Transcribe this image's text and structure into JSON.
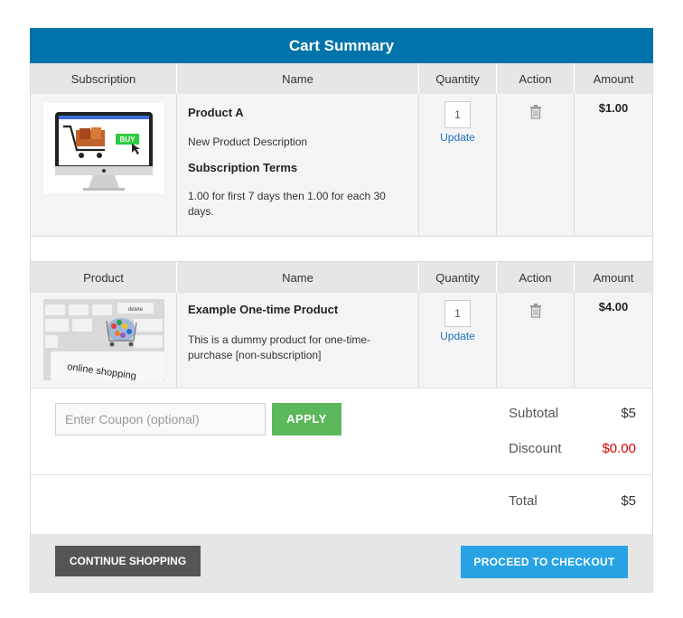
{
  "cart": {
    "title": "Cart Summary",
    "subscription_table": {
      "headers": [
        "Subscription",
        "Name",
        "Quantity",
        "Action",
        "Amount"
      ],
      "item": {
        "name": "Product A",
        "description": "New Product Description",
        "terms_heading": "Subscription Terms",
        "terms_text": "1.00 for first 7 days then 1.00 for each 30 days.",
        "quantity": "1",
        "update_label": "Update",
        "amount": "$1.00",
        "image_badge": "BUY"
      }
    },
    "product_table": {
      "headers": [
        "Product",
        "Name",
        "Quantity",
        "Action",
        "Amount"
      ],
      "item": {
        "name": "Example One-time Product",
        "description": "This is a dummy product for one-time-purchase [non-subscription]",
        "quantity": "1",
        "update_label": "Update",
        "amount": "$4.00",
        "image_text": "online shopping",
        "image_key_text": "delete"
      }
    },
    "coupon": {
      "placeholder": "Enter Coupon (optional)",
      "apply_label": "APPLY"
    },
    "totals": {
      "subtotal_label": "Subtotal",
      "subtotal_value": "$5",
      "discount_label": "Discount",
      "discount_value": "$0.00",
      "total_label": "Total",
      "total_value": "$5"
    },
    "buttons": {
      "continue_label": "CONTINUE SHOPPING",
      "checkout_label": "PROCEED TO CHECKOUT"
    },
    "colors": {
      "header_blue": "#0073aa",
      "apply_green": "#5cb85c",
      "checkout_blue": "#27a3e4",
      "discount_red": "#dd0000"
    }
  }
}
